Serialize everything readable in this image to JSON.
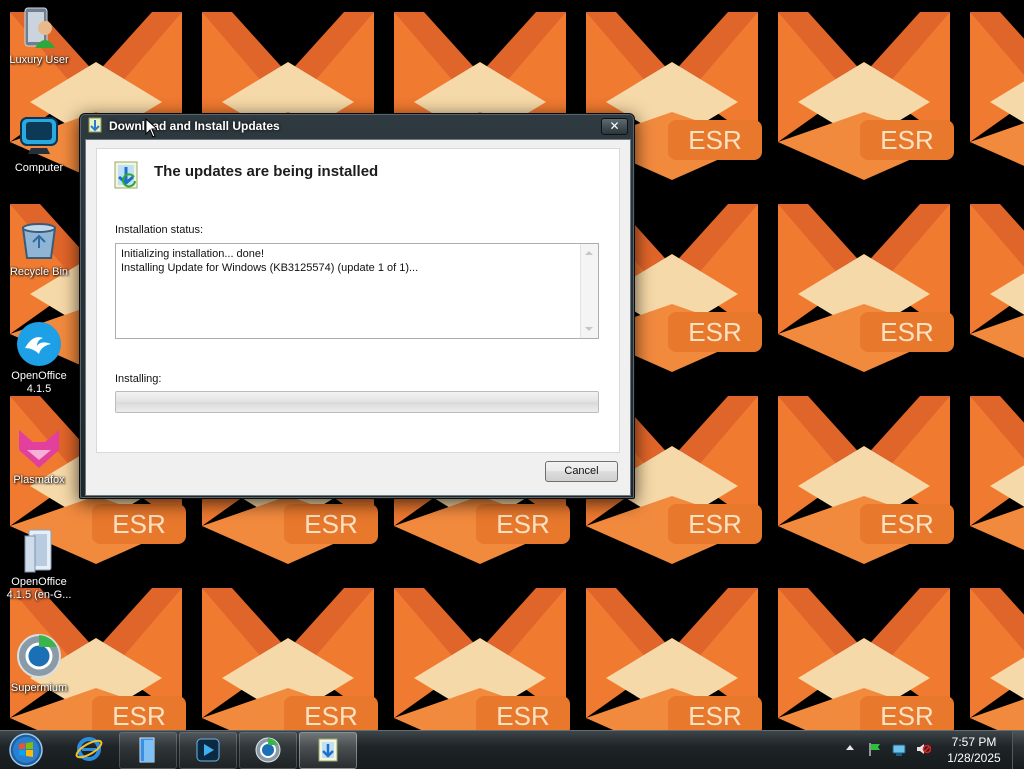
{
  "desktop": {
    "icons": [
      {
        "label": "Luxury User",
        "icon": "user-icon"
      },
      {
        "label": "Computer",
        "icon": "computer-icon"
      },
      {
        "label": "Recycle Bin",
        "icon": "recycle-bin-icon"
      },
      {
        "label": "OpenOffice 4.1.5",
        "icon": "openoffice-icon"
      },
      {
        "label": "Plasmafox",
        "icon": "plasmafox-icon"
      },
      {
        "label": "OpenOffice 4.1.5 (en-G...",
        "icon": "installer-icon"
      },
      {
        "label": "Supermium",
        "icon": "supermium-icon"
      }
    ],
    "wallpaper_text": "ESR",
    "colors": {
      "wallpaper_orange": "#f07a30",
      "wallpaper_cream": "#f6d9a8",
      "wallpaper_bg": "#000000"
    }
  },
  "dialog": {
    "title": "Download and Install Updates",
    "close_label": "✕",
    "heading": "The updates are being installed",
    "status_label": "Installation status:",
    "status_lines": [
      "Initializing installation... done!",
      "Installing Update for Windows (KB3125574) (update 1 of 1)..."
    ],
    "installing_label": "Installing:",
    "progress": 0,
    "cancel_label": "Cancel"
  },
  "taskbar": {
    "buttons": [
      {
        "name": "internet-explorer",
        "icon": "internet-explorer-icon",
        "state": "normal"
      },
      {
        "name": "file-explorer",
        "icon": "folder-icon",
        "state": "pinned"
      },
      {
        "name": "media-player",
        "icon": "media-player-icon",
        "state": "pinned"
      },
      {
        "name": "supermium",
        "icon": "supermium-icon",
        "state": "pinned"
      },
      {
        "name": "windows-update",
        "icon": "windows-update-icon",
        "state": "active"
      }
    ],
    "tray_icons": [
      "action-center-flag-icon",
      "network-icon",
      "volume-muted-icon"
    ],
    "clock": {
      "time": "7:57 PM",
      "date": "1/28/2025"
    }
  }
}
